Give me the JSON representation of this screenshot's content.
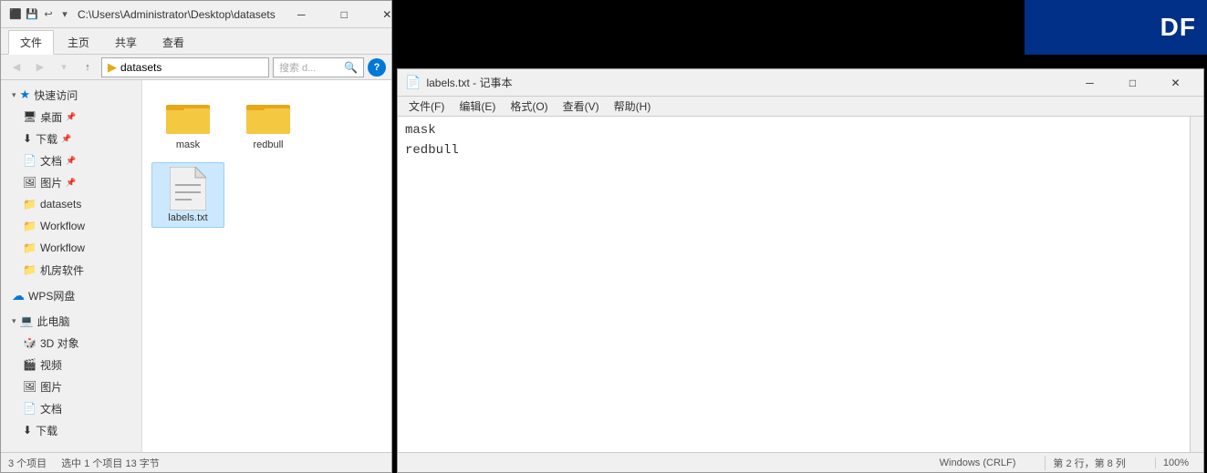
{
  "brand": {
    "text": "DF"
  },
  "explorer": {
    "title_bar": {
      "path": "C:\\Users\\Administrator\\Desktop\\datasets",
      "controls": [
        "minimize",
        "maximize",
        "close"
      ]
    },
    "ribbon": {
      "tabs": [
        "文件",
        "主页",
        "共享",
        "查看"
      ]
    },
    "address": {
      "path": "datasets",
      "search_placeholder": "搜索 d..."
    },
    "sidebar": {
      "sections": [
        {
          "label": "快速访问",
          "items": [
            {
              "label": "桌面",
              "icon": "desktop",
              "pinned": true,
              "indent": 1
            },
            {
              "label": "下载",
              "icon": "download",
              "pinned": true,
              "indent": 1
            },
            {
              "label": "文档",
              "icon": "document",
              "pinned": true,
              "indent": 1
            },
            {
              "label": "图片",
              "icon": "picture",
              "pinned": true,
              "indent": 1
            },
            {
              "label": "datasets",
              "icon": "folder",
              "indent": 1
            },
            {
              "label": "Workflow",
              "icon": "folder",
              "indent": 1
            },
            {
              "label": "Workflow",
              "icon": "folder",
              "indent": 1
            },
            {
              "label": "机房软件",
              "icon": "folder",
              "indent": 1
            }
          ]
        },
        {
          "label": "WPS网盘",
          "items": []
        },
        {
          "label": "此电脑",
          "items": [
            {
              "label": "3D 对象",
              "icon": "3d",
              "indent": 1
            },
            {
              "label": "视频",
              "icon": "video",
              "indent": 1
            },
            {
              "label": "图片",
              "icon": "picture",
              "indent": 1
            },
            {
              "label": "文档",
              "icon": "document",
              "indent": 1
            },
            {
              "label": "下载",
              "icon": "download",
              "indent": 1
            }
          ]
        }
      ]
    },
    "files": [
      {
        "name": "mask",
        "type": "folder"
      },
      {
        "name": "redbull",
        "type": "folder"
      },
      {
        "name": "labels.txt",
        "type": "text"
      }
    ],
    "status_bar": {
      "count": "3 个项目",
      "selected": "选中 1 个项目  13 字节"
    }
  },
  "notepad": {
    "title": "labels.txt - 记事本",
    "icon": "📄",
    "menu": [
      "文件(F)",
      "编辑(E)",
      "格式(O)",
      "查看(V)",
      "帮助(H)"
    ],
    "content": "mask\nredbull",
    "status": {
      "encoding": "Windows (CRLF)",
      "position": "第 2 行，第 8 列",
      "zoom": "100%"
    }
  }
}
